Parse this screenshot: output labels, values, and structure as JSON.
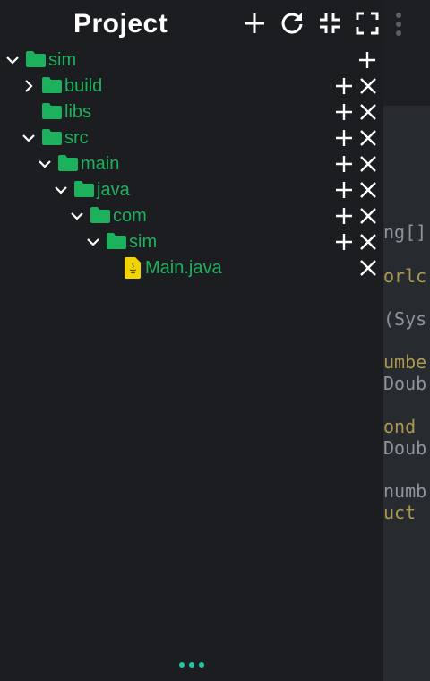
{
  "header": {
    "title": "Project",
    "actions": [
      "plus-icon",
      "refresh-icon",
      "collapse-icon",
      "fullscreen-icon"
    ]
  },
  "tree": [
    {
      "label": "sim",
      "type": "folder",
      "expanded": true,
      "add": true,
      "remove": false
    },
    {
      "label": "build",
      "type": "folder",
      "expanded": false,
      "add": true,
      "remove": true
    },
    {
      "label": "libs",
      "type": "folder",
      "expanded": null,
      "add": true,
      "remove": true
    },
    {
      "label": "src",
      "type": "folder",
      "expanded": true,
      "add": true,
      "remove": true
    },
    {
      "label": "main",
      "type": "folder",
      "expanded": true,
      "add": true,
      "remove": true
    },
    {
      "label": "java",
      "type": "folder",
      "expanded": true,
      "add": true,
      "remove": true
    },
    {
      "label": "com",
      "type": "folder",
      "expanded": true,
      "add": true,
      "remove": true
    },
    {
      "label": "sim",
      "type": "folder",
      "expanded": true,
      "add": true,
      "remove": true
    },
    {
      "label": "Main.java",
      "type": "java-file",
      "expanded": null,
      "add": false,
      "remove": true
    }
  ],
  "editor_fragments": [
    "ng[]",
    "orlc",
    "(Sys",
    "umbe",
    "Doub",
    "ond",
    "Doub",
    "numb",
    "uct"
  ],
  "colors": {
    "folder": "#1cb15c",
    "label": "#1cb15c",
    "accent": "#1ec8a5",
    "java_file": "#f2d500"
  }
}
